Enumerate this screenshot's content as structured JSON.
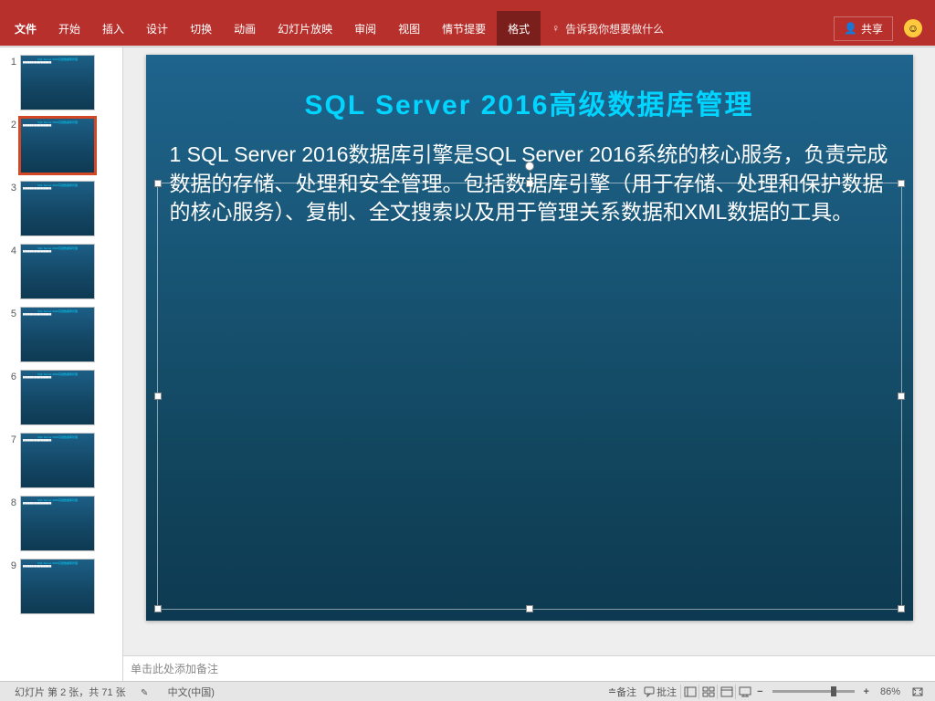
{
  "ribbon": {
    "tabs": {
      "file": "文件",
      "home": "开始",
      "insert": "插入",
      "design": "设计",
      "transitions": "切换",
      "animations": "动画",
      "slideshow": "幻灯片放映",
      "review": "审阅",
      "view": "视图",
      "storyboard": "情节提要",
      "format": "格式"
    },
    "tellme_placeholder": "告诉我你想要做什么",
    "share": "共享"
  },
  "thumbnails": {
    "items": [
      {
        "num": "1"
      },
      {
        "num": "2"
      },
      {
        "num": "3"
      },
      {
        "num": "4"
      },
      {
        "num": "5"
      },
      {
        "num": "6"
      },
      {
        "num": "7"
      },
      {
        "num": "8"
      },
      {
        "num": "9"
      }
    ],
    "selected_index": 1
  },
  "slide": {
    "title": "SQL Server 2016高级数据库管理",
    "body": "1  SQL Server 2016数据库引擎是SQL Server 2016系统的核心服务，负责完成数据的存储、处理和安全管理。包括数据库引擎（用于存储、处理和保护数据的核心服务）、复制、全文搜索以及用于管理关系数据和XML数据的工具。"
  },
  "notes": {
    "placeholder": "单击此处添加备注"
  },
  "statusbar": {
    "slide_info": "幻灯片 第 2 张，共 71 张",
    "language": "中文(中国)",
    "remarks": "备注",
    "comments": "批注",
    "zoom_value": "86%"
  }
}
